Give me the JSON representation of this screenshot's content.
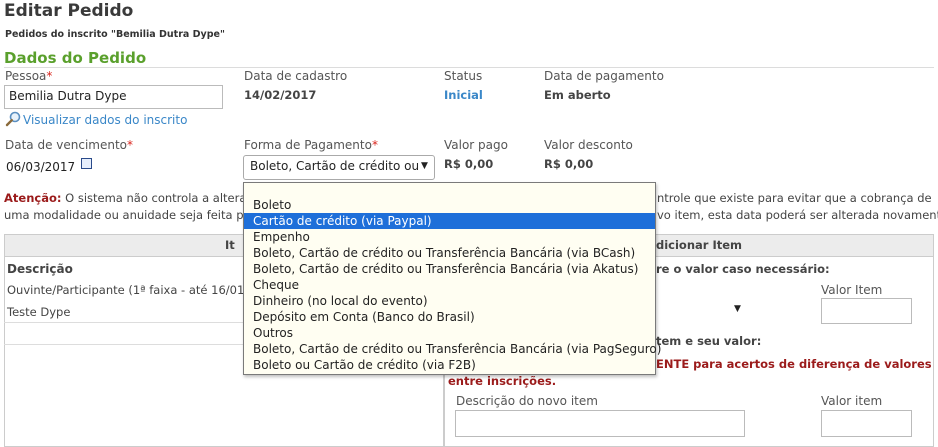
{
  "page": {
    "title": "Editar Pedido",
    "subtitle": "Pedidos do inscrito \"Bemilia Dutra Dype\"",
    "section_title": "Dados do Pedido"
  },
  "form": {
    "pessoa_label": "Pessoa",
    "required_mark": "*",
    "pessoa_value": "Bemilia Dutra Dype",
    "view_link": "Visualizar dados do inscrito",
    "data_cadastro_label": "Data de cadastro",
    "data_cadastro_value": "14/02/2017",
    "status_label": "Status",
    "status_value": "Inicial",
    "data_pagamento_label": "Data de pagamento",
    "data_pagamento_value": "Em aberto",
    "vencimento_label": "Data de vencimento",
    "vencimento_value": "06/03/2017",
    "forma_label": "Forma de Pagamento",
    "forma_value": "Boleto, Cartão de crédito ou",
    "valor_pago_label": "Valor pago",
    "valor_pago_value": "R$ 0,00",
    "valor_desconto_label": "Valor desconto",
    "valor_desconto_value": "R$ 0,00"
  },
  "warning": {
    "prefix": "Atenção:",
    "line1_left": "O sistema não controla a alteraçã",
    "line1_right": "ntrole que existe para evitar que a cobrança de",
    "line2_left": "uma modalidade ou anuidade seja feita port",
    "line2_right": "vo item, esta data poderá ser alterada novamente!"
  },
  "items_panel": {
    "header": "It",
    "col_descricao": "Descrição",
    "row1": "Ouvinte/Participante (1ª faixa - até 16/01/20",
    "row2": "Teste Dype"
  },
  "add_panel": {
    "header": "dicionar Item",
    "hint1": "re o valor caso necessário:",
    "valor_item_label": "Valor Item",
    "hint2": "tem e seu valor:",
    "warn_line1": "ENTE para acertos de diferença de valores",
    "warn_line2": "entre inscrições.",
    "novo_item_label": "Descrição do novo item",
    "valor_item2_label": "Valor item"
  },
  "dropdown": {
    "options": [
      "Boleto",
      "Cartão de crédito (via Paypal)",
      "Empenho",
      "Boleto, Cartão de crédito ou Transferência Bancária (via BCash)",
      "Boleto, Cartão de crédito ou Transferência Bancária (via Akatus)",
      "Cheque",
      "Dinheiro (no local do evento)",
      "Depósito em Conta (Banco do Brasil)",
      "Outros",
      "Boleto, Cartão de crédito ou Transferência Bancária (via PagSeguro)",
      "Boleto ou Cartão de crédito (via F2B)"
    ],
    "highlighted_index": 1
  },
  "colors": {
    "section": "#5aa02c",
    "link": "#3a87c8",
    "highlight": "#1e6fd9",
    "warn": "#9b1b1b"
  }
}
